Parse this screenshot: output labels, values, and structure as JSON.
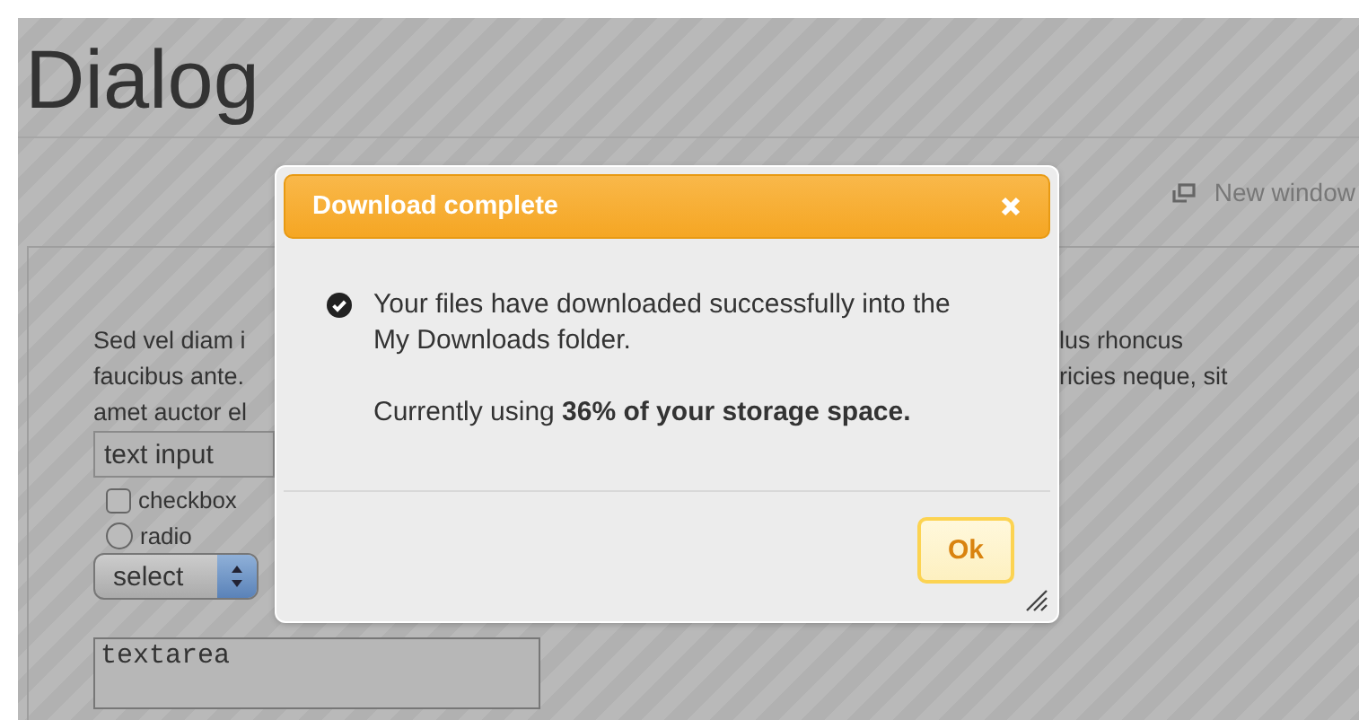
{
  "page": {
    "title": "Dialog",
    "new_window_link": "New window",
    "paragraph_left": [
      "Sed vel diam i",
      "faucibus ante.",
      "amet auctor el"
    ],
    "paragraph_right": [
      "lus rhoncus",
      "ricies neque, sit"
    ],
    "text_input": {
      "value": "text input"
    },
    "checkbox": {
      "label": "checkbox",
      "checked": false
    },
    "radio": {
      "label": "radio",
      "selected": false
    },
    "select": {
      "value": "select"
    },
    "textarea": {
      "value": "textarea"
    }
  },
  "dialog": {
    "title": "Download complete",
    "message": "Your files have downloaded successfully into the My Downloads folder.",
    "usage": "Currently using **36% of your storage space.**",
    "button": "Ok"
  }
}
